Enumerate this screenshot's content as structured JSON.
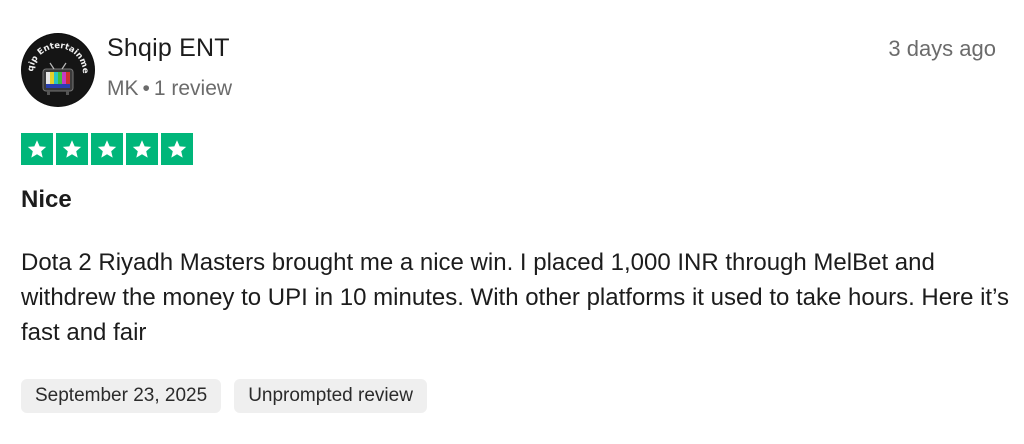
{
  "reviewer": {
    "name": "Shqip ENT",
    "country": "MK",
    "separator": "•",
    "review_count": "1 review",
    "avatar_text": "Shqip Entertainment"
  },
  "review": {
    "relative_date": "3 days ago",
    "rating": 5,
    "rating_max": 5,
    "star_color": "#00b67a",
    "title": "Nice",
    "body": "Dota 2 Riyadh Masters brought me a nice win. I placed 1,000 INR through MelBet and withdrew the money to UPI in 10 minutes. With other platforms it used to take hours. Here it’s fast and fair",
    "tags": [
      {
        "label": "September 23, 2025"
      },
      {
        "label": "Unprompted review"
      }
    ]
  },
  "icons": {
    "star": "star-icon",
    "avatar": "tv-logo-icon"
  }
}
